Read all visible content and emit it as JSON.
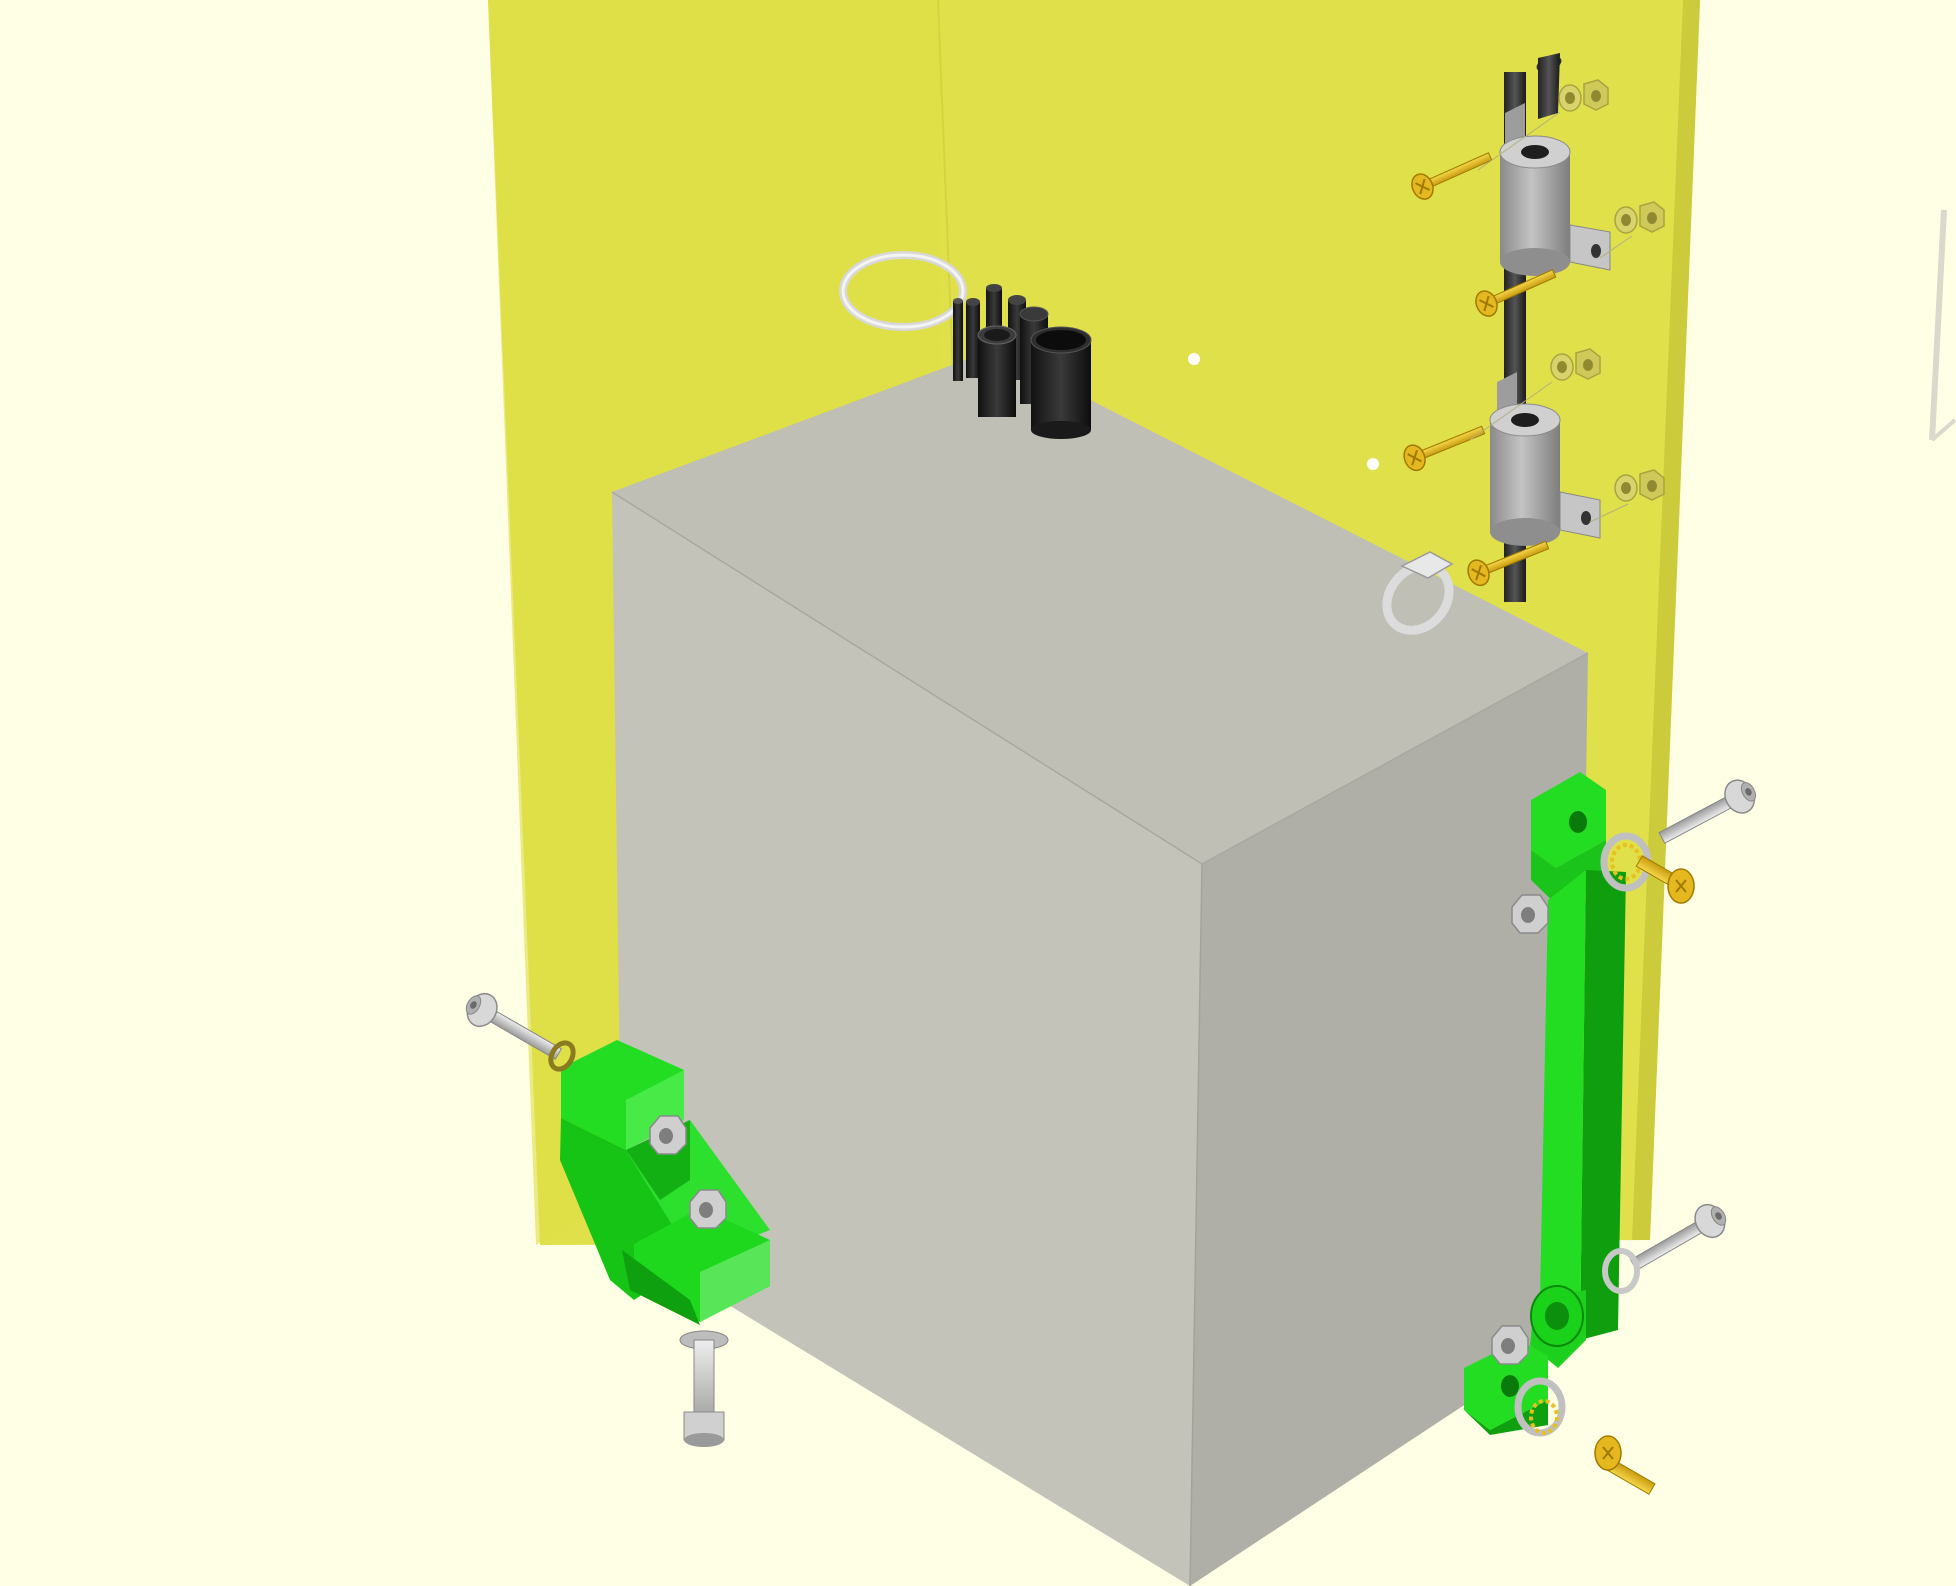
{
  "viewport": {
    "background": "#ffffe6",
    "colors": {
      "panel": "#e0e04a",
      "panel_edge": "#c8c83a",
      "tank_top": "#bfbfb6",
      "tank_front": "#c3c3ba",
      "tank_side": "#afafa8",
      "bracket": "#22dd22",
      "bracket_dark": "#009900",
      "screw_gold": "#e8c020",
      "steel": "#b8b8b8",
      "pipe_dark": "#2a2a2a"
    },
    "parts": [
      {
        "name": "back-panel",
        "color": "panel"
      },
      {
        "name": "tank",
        "color": "tank_front"
      },
      {
        "name": "left-bracket",
        "color": "bracket"
      },
      {
        "name": "right-bracket",
        "color": "bracket"
      },
      {
        "name": "rod-holder-upper",
        "color": "steel"
      },
      {
        "name": "rod-holder-lower",
        "color": "steel"
      },
      {
        "name": "pipe-fittings",
        "color": "pipe_dark"
      },
      {
        "name": "hose-clamp",
        "color": "steel"
      },
      {
        "name": "o-ring",
        "color": "steel"
      }
    ]
  }
}
